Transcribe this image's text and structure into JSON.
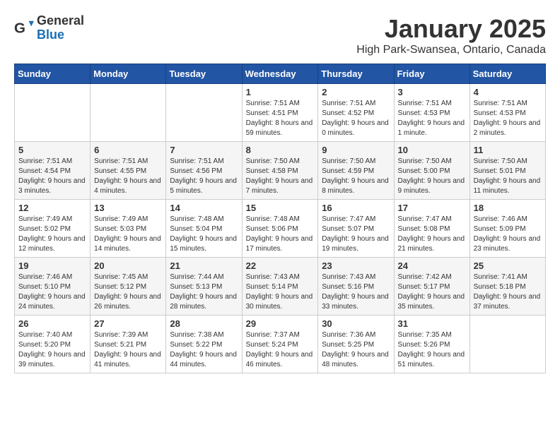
{
  "header": {
    "logo_general": "General",
    "logo_blue": "Blue",
    "month_title": "January 2025",
    "location": "High Park-Swansea, Ontario, Canada"
  },
  "weekdays": [
    "Sunday",
    "Monday",
    "Tuesday",
    "Wednesday",
    "Thursday",
    "Friday",
    "Saturday"
  ],
  "weeks": [
    [
      {
        "day": "",
        "info": ""
      },
      {
        "day": "",
        "info": ""
      },
      {
        "day": "",
        "info": ""
      },
      {
        "day": "1",
        "info": "Sunrise: 7:51 AM\nSunset: 4:51 PM\nDaylight: 8 hours and 59 minutes."
      },
      {
        "day": "2",
        "info": "Sunrise: 7:51 AM\nSunset: 4:52 PM\nDaylight: 9 hours and 0 minutes."
      },
      {
        "day": "3",
        "info": "Sunrise: 7:51 AM\nSunset: 4:53 PM\nDaylight: 9 hours and 1 minute."
      },
      {
        "day": "4",
        "info": "Sunrise: 7:51 AM\nSunset: 4:53 PM\nDaylight: 9 hours and 2 minutes."
      }
    ],
    [
      {
        "day": "5",
        "info": "Sunrise: 7:51 AM\nSunset: 4:54 PM\nDaylight: 9 hours and 3 minutes."
      },
      {
        "day": "6",
        "info": "Sunrise: 7:51 AM\nSunset: 4:55 PM\nDaylight: 9 hours and 4 minutes."
      },
      {
        "day": "7",
        "info": "Sunrise: 7:51 AM\nSunset: 4:56 PM\nDaylight: 9 hours and 5 minutes."
      },
      {
        "day": "8",
        "info": "Sunrise: 7:50 AM\nSunset: 4:58 PM\nDaylight: 9 hours and 7 minutes."
      },
      {
        "day": "9",
        "info": "Sunrise: 7:50 AM\nSunset: 4:59 PM\nDaylight: 9 hours and 8 minutes."
      },
      {
        "day": "10",
        "info": "Sunrise: 7:50 AM\nSunset: 5:00 PM\nDaylight: 9 hours and 9 minutes."
      },
      {
        "day": "11",
        "info": "Sunrise: 7:50 AM\nSunset: 5:01 PM\nDaylight: 9 hours and 11 minutes."
      }
    ],
    [
      {
        "day": "12",
        "info": "Sunrise: 7:49 AM\nSunset: 5:02 PM\nDaylight: 9 hours and 12 minutes."
      },
      {
        "day": "13",
        "info": "Sunrise: 7:49 AM\nSunset: 5:03 PM\nDaylight: 9 hours and 14 minutes."
      },
      {
        "day": "14",
        "info": "Sunrise: 7:48 AM\nSunset: 5:04 PM\nDaylight: 9 hours and 15 minutes."
      },
      {
        "day": "15",
        "info": "Sunrise: 7:48 AM\nSunset: 5:06 PM\nDaylight: 9 hours and 17 minutes."
      },
      {
        "day": "16",
        "info": "Sunrise: 7:47 AM\nSunset: 5:07 PM\nDaylight: 9 hours and 19 minutes."
      },
      {
        "day": "17",
        "info": "Sunrise: 7:47 AM\nSunset: 5:08 PM\nDaylight: 9 hours and 21 minutes."
      },
      {
        "day": "18",
        "info": "Sunrise: 7:46 AM\nSunset: 5:09 PM\nDaylight: 9 hours and 23 minutes."
      }
    ],
    [
      {
        "day": "19",
        "info": "Sunrise: 7:46 AM\nSunset: 5:10 PM\nDaylight: 9 hours and 24 minutes."
      },
      {
        "day": "20",
        "info": "Sunrise: 7:45 AM\nSunset: 5:12 PM\nDaylight: 9 hours and 26 minutes."
      },
      {
        "day": "21",
        "info": "Sunrise: 7:44 AM\nSunset: 5:13 PM\nDaylight: 9 hours and 28 minutes."
      },
      {
        "day": "22",
        "info": "Sunrise: 7:43 AM\nSunset: 5:14 PM\nDaylight: 9 hours and 30 minutes."
      },
      {
        "day": "23",
        "info": "Sunrise: 7:43 AM\nSunset: 5:16 PM\nDaylight: 9 hours and 33 minutes."
      },
      {
        "day": "24",
        "info": "Sunrise: 7:42 AM\nSunset: 5:17 PM\nDaylight: 9 hours and 35 minutes."
      },
      {
        "day": "25",
        "info": "Sunrise: 7:41 AM\nSunset: 5:18 PM\nDaylight: 9 hours and 37 minutes."
      }
    ],
    [
      {
        "day": "26",
        "info": "Sunrise: 7:40 AM\nSunset: 5:20 PM\nDaylight: 9 hours and 39 minutes."
      },
      {
        "day": "27",
        "info": "Sunrise: 7:39 AM\nSunset: 5:21 PM\nDaylight: 9 hours and 41 minutes."
      },
      {
        "day": "28",
        "info": "Sunrise: 7:38 AM\nSunset: 5:22 PM\nDaylight: 9 hours and 44 minutes."
      },
      {
        "day": "29",
        "info": "Sunrise: 7:37 AM\nSunset: 5:24 PM\nDaylight: 9 hours and 46 minutes."
      },
      {
        "day": "30",
        "info": "Sunrise: 7:36 AM\nSunset: 5:25 PM\nDaylight: 9 hours and 48 minutes."
      },
      {
        "day": "31",
        "info": "Sunrise: 7:35 AM\nSunset: 5:26 PM\nDaylight: 9 hours and 51 minutes."
      },
      {
        "day": "",
        "info": ""
      }
    ]
  ]
}
